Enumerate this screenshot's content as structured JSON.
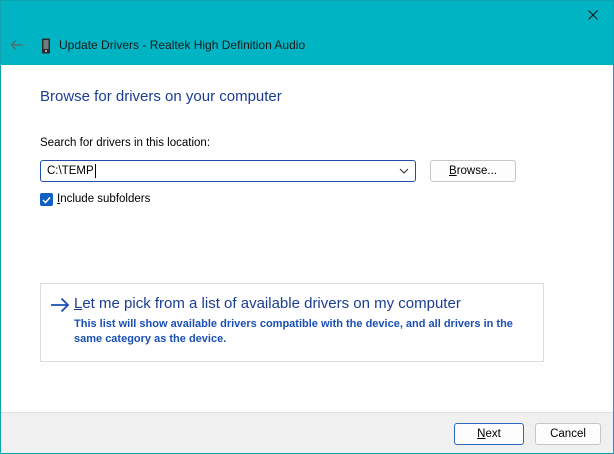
{
  "window": {
    "title": "Update Drivers - Realtek High Definition Audio",
    "accent_color": "#00b4c3"
  },
  "page": {
    "heading": "Browse for drivers on your computer",
    "search_label": "Search for drivers in this location:",
    "path_value": "C:\\TEMP",
    "browse_pre": "",
    "browse_key": "B",
    "browse_post": "rowse...",
    "include_key": "I",
    "include_post": "nclude subfolders",
    "include_checked": true
  },
  "pick": {
    "title_key": "L",
    "title_post": "et me pick from a list of available drivers on my computer",
    "description": "This list will show available drivers compatible with the device, and all drivers in the same category as the device."
  },
  "footer": {
    "next_key": "N",
    "next_post": "ext",
    "cancel_label": "Cancel"
  }
}
